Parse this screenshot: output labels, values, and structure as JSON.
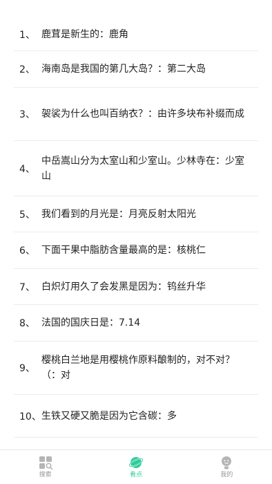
{
  "items": [
    {
      "num": "1、",
      "text": "鹿茸是新生的：鹿角"
    },
    {
      "num": "2、",
      "text": "海南岛是我国的第几大岛？：第二大岛"
    },
    {
      "num": "3、",
      "text": "袈裟为什么也叫百纳衣？：由许多块布补缀而成"
    },
    {
      "num": "4、",
      "text": "中岳嵩山分为太室山和少室山。少林寺在：少室山"
    },
    {
      "num": "5、",
      "text": "我们看到的月光是：月亮反射太阳光"
    },
    {
      "num": "6、",
      "text": "下面干果中脂肪含量最高的是：核桃仁"
    },
    {
      "num": "7、",
      "text": "白炽灯用久了会发黑是因为：钨丝升华"
    },
    {
      "num": "8、",
      "text": "法国的国庆日是：7.14"
    },
    {
      "num": "9、",
      "text": "樱桃白兰地是用樱桃作原料酿制的，对不对？（：对"
    },
    {
      "num": "10、",
      "text": "生铁又硬又脆是因为它含碳：多"
    }
  ],
  "tabs": [
    {
      "id": "search",
      "label": "搜索",
      "icon": "grid-search-icon"
    },
    {
      "id": "look",
      "label": "看点",
      "icon": "planet-icon"
    },
    {
      "id": "mine",
      "label": "我的",
      "icon": "person-icon"
    }
  ],
  "active_tab": "look",
  "colors": {
    "accent": "#2ecc9a",
    "inactive": "#999999",
    "text": "#222222",
    "divider": "#ececec"
  }
}
